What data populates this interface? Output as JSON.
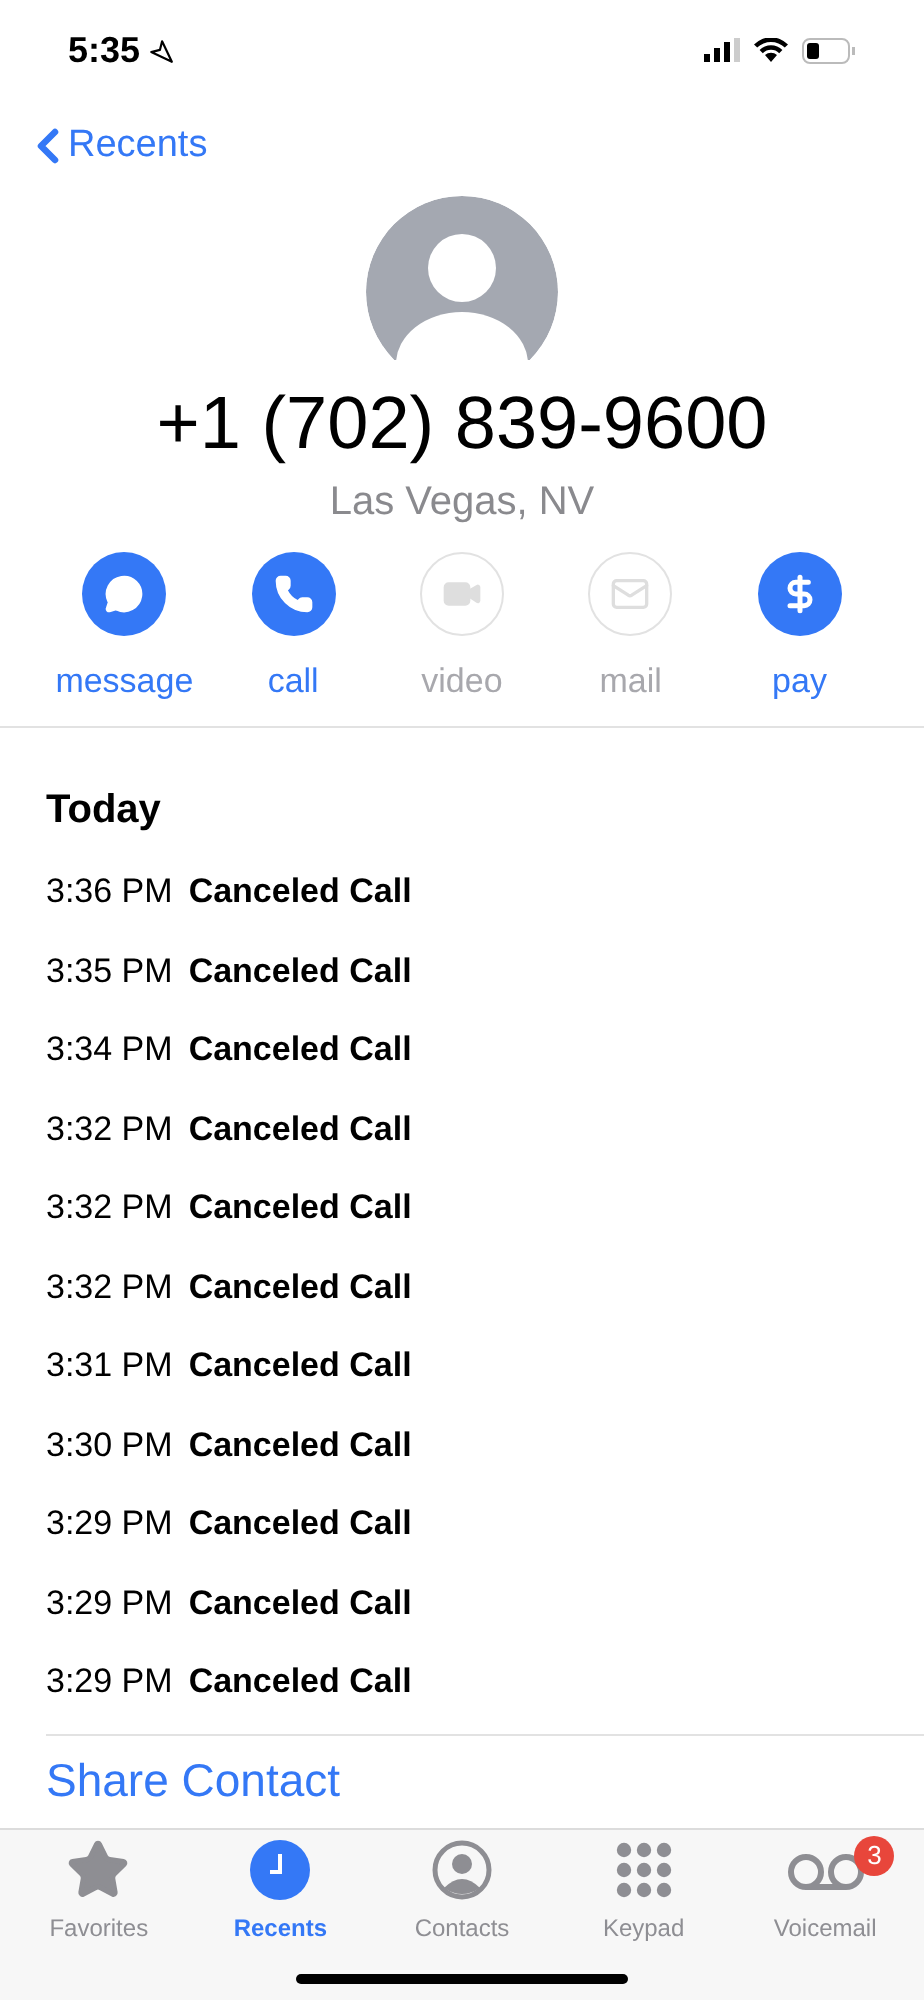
{
  "status_bar": {
    "time": "5:35"
  },
  "nav": {
    "back_label": "Recents"
  },
  "contact": {
    "phone": "+1 (702) 839-9600",
    "location": "Las Vegas, NV"
  },
  "actions": [
    {
      "kind": "message",
      "label": "message",
      "disabled": false
    },
    {
      "kind": "call",
      "label": "call",
      "disabled": false
    },
    {
      "kind": "video",
      "label": "video",
      "disabled": true
    },
    {
      "kind": "mail",
      "label": "mail",
      "disabled": true
    },
    {
      "kind": "pay",
      "label": "pay",
      "disabled": false
    }
  ],
  "history": {
    "heading": "Today",
    "calls": [
      {
        "time": "3:36 PM",
        "status": "Canceled Call"
      },
      {
        "time": "3:35 PM",
        "status": "Canceled Call"
      },
      {
        "time": "3:34 PM",
        "status": "Canceled Call"
      },
      {
        "time": "3:32 PM",
        "status": "Canceled Call"
      },
      {
        "time": "3:32 PM",
        "status": "Canceled Call"
      },
      {
        "time": "3:32 PM",
        "status": "Canceled Call"
      },
      {
        "time": "3:31 PM",
        "status": "Canceled Call"
      },
      {
        "time": "3:30 PM",
        "status": "Canceled Call"
      },
      {
        "time": "3:29 PM",
        "status": "Canceled Call"
      },
      {
        "time": "3:29 PM",
        "status": "Canceled Call"
      },
      {
        "time": "3:29 PM",
        "status": "Canceled Call"
      }
    ]
  },
  "share_link": "Share Contact",
  "tab_bar": [
    {
      "kind": "favorites",
      "label": "Favorites",
      "selected": false
    },
    {
      "kind": "recents",
      "label": "Recents",
      "selected": true
    },
    {
      "kind": "contacts",
      "label": "Contacts",
      "selected": false
    },
    {
      "kind": "keypad",
      "label": "Keypad",
      "selected": false
    },
    {
      "kind": "voicemail",
      "label": "Voicemail",
      "selected": false,
      "badge": "3"
    }
  ]
}
